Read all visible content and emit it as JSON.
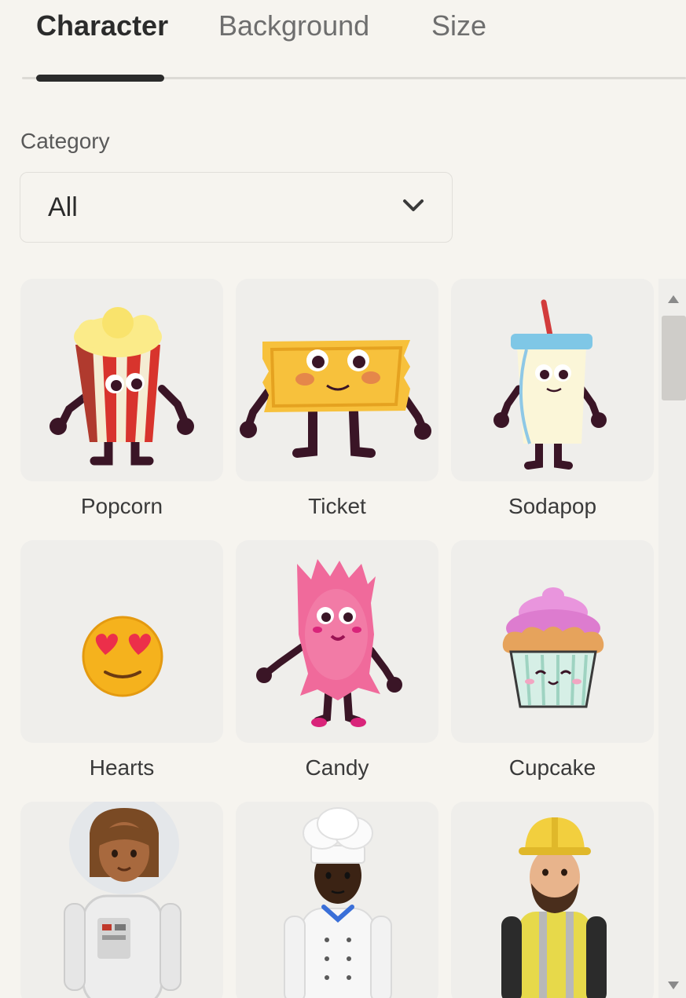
{
  "tabs": [
    {
      "label": "Character",
      "active": true
    },
    {
      "label": "Background",
      "active": false
    },
    {
      "label": "Size",
      "active": false
    }
  ],
  "category": {
    "label": "Category",
    "value": "All",
    "icon": "chevron-down-icon"
  },
  "characters": [
    {
      "name": "Popcorn",
      "icon": "popcorn-character-icon"
    },
    {
      "name": "Ticket",
      "icon": "ticket-character-icon"
    },
    {
      "name": "Sodapop",
      "icon": "sodapop-character-icon"
    },
    {
      "name": "Hearts",
      "icon": "hearts-emoji-icon"
    },
    {
      "name": "Candy",
      "icon": "candy-character-icon"
    },
    {
      "name": "Cupcake",
      "icon": "cupcake-character-icon"
    },
    {
      "name": "",
      "icon": "astronaut-character-icon"
    },
    {
      "name": "",
      "icon": "chef-character-icon"
    },
    {
      "name": "",
      "icon": "construction-worker-character-icon"
    }
  ],
  "colors": {
    "background": "#f6f4ef",
    "card": "#efeeeb",
    "text": "#2b2b2b",
    "limb": "#3a1526",
    "ticket_yellow": "#f7c13c",
    "candy_pink": "#f06a9b",
    "cupcake_frosting": "#e995dd"
  }
}
